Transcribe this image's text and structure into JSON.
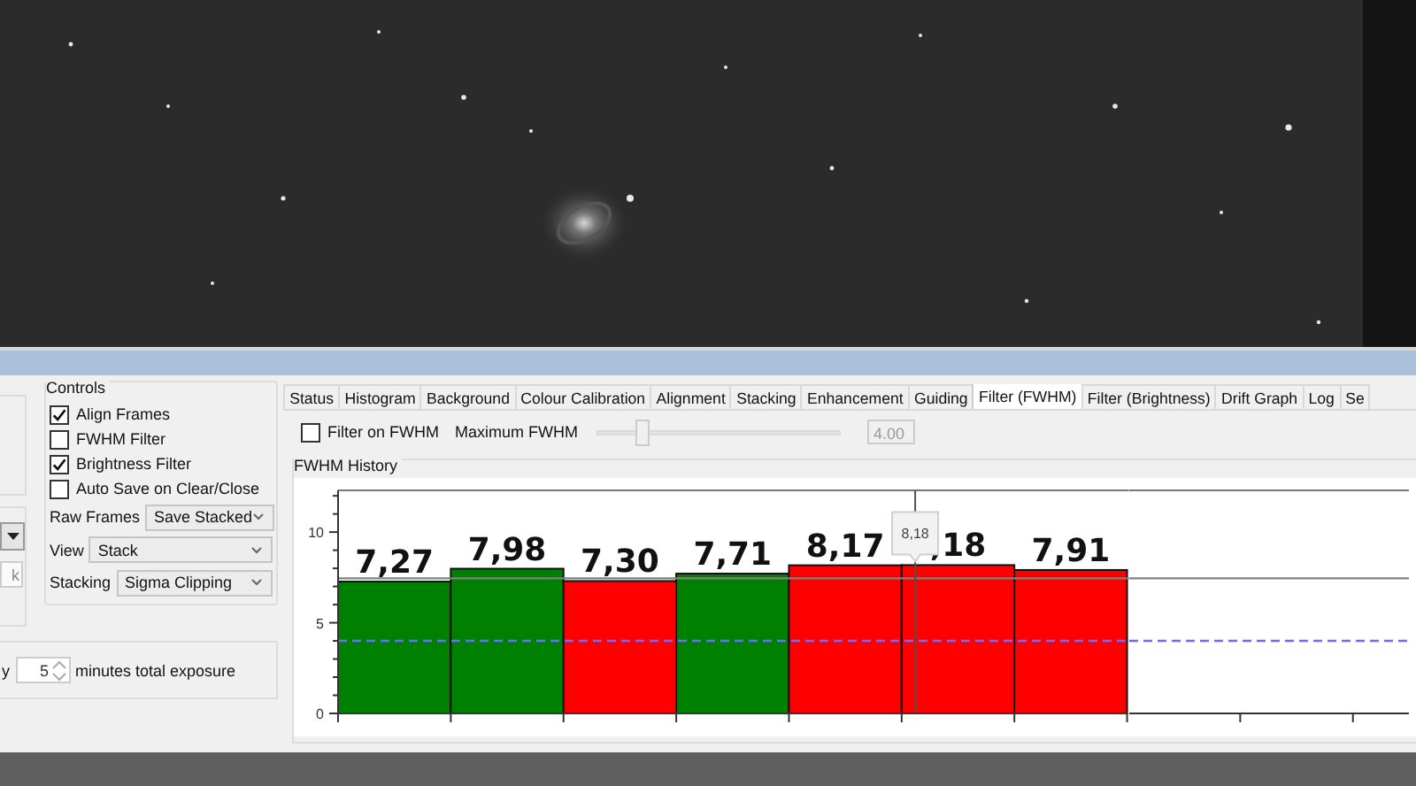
{
  "left_panel": {
    "field_text": "k",
    "spin_label": "y",
    "spin_value": "5",
    "spin_suffix": "minutes total exposure"
  },
  "controls": {
    "title": "Controls",
    "checkboxes": [
      {
        "label": "Align Frames",
        "checked": true
      },
      {
        "label": "FWHM Filter",
        "checked": false
      },
      {
        "label": "Brightness Filter",
        "checked": true
      },
      {
        "label": "Auto Save on Clear/Close",
        "checked": false
      }
    ],
    "combos": [
      {
        "label": "Raw Frames",
        "value": "Save Stacked"
      },
      {
        "label": "View",
        "value": "Stack"
      },
      {
        "label": "Stacking",
        "value": "Sigma Clipping"
      }
    ]
  },
  "tabs": [
    {
      "label": "Status",
      "selected": false
    },
    {
      "label": "Histogram",
      "selected": false
    },
    {
      "label": "Background",
      "selected": false
    },
    {
      "label": "Colour Calibration",
      "selected": false
    },
    {
      "label": "Alignment",
      "selected": false
    },
    {
      "label": "Stacking",
      "selected": false
    },
    {
      "label": "Enhancement",
      "selected": false
    },
    {
      "label": "Guiding",
      "selected": false
    },
    {
      "label": "Filter (FWHM)",
      "selected": true
    },
    {
      "label": "Filter (Brightness)",
      "selected": false
    },
    {
      "label": "Drift Graph",
      "selected": false
    },
    {
      "label": "Log",
      "selected": false
    },
    {
      "label": "Se",
      "selected": false
    }
  ],
  "fwhm_filter": {
    "checkbox_label": "Filter on FWHM",
    "checked": false,
    "slider_label": "Maximum FWHM",
    "level": 0.18,
    "value": "4.00",
    "disabled": true
  },
  "fwhm_history": {
    "title": "FWHM History",
    "bars": [
      {
        "color": "#008000",
        "label": "7,27"
      },
      {
        "color": "#008000",
        "label": "7,98"
      },
      {
        "color": "#ff0000",
        "label": "7,30"
      },
      {
        "color": "#008000",
        "label": "7,71"
      },
      {
        "color": "#ff0000",
        "label": "8,17"
      },
      {
        "color": "#ff0000",
        "label": ",18",
        "tooltip": "8,18"
      },
      {
        "color": "#ff0000",
        "label": "7,91"
      }
    ],
    "chart_data": {
      "type": "bar",
      "categories": [
        null,
        null,
        null,
        null,
        null,
        null,
        null
      ],
      "ylim": [
        0,
        12.3
      ],
      "yticks": [
        0,
        5,
        10
      ],
      "values": [
        7.27,
        7.98,
        7.3,
        7.71,
        8.17,
        8.18,
        7.91
      ],
      "ref_lines": [
        {
          "axis": "y",
          "value": 7.45
        },
        {
          "axis": "y",
          "value": 4
        }
      ]
    }
  }
}
